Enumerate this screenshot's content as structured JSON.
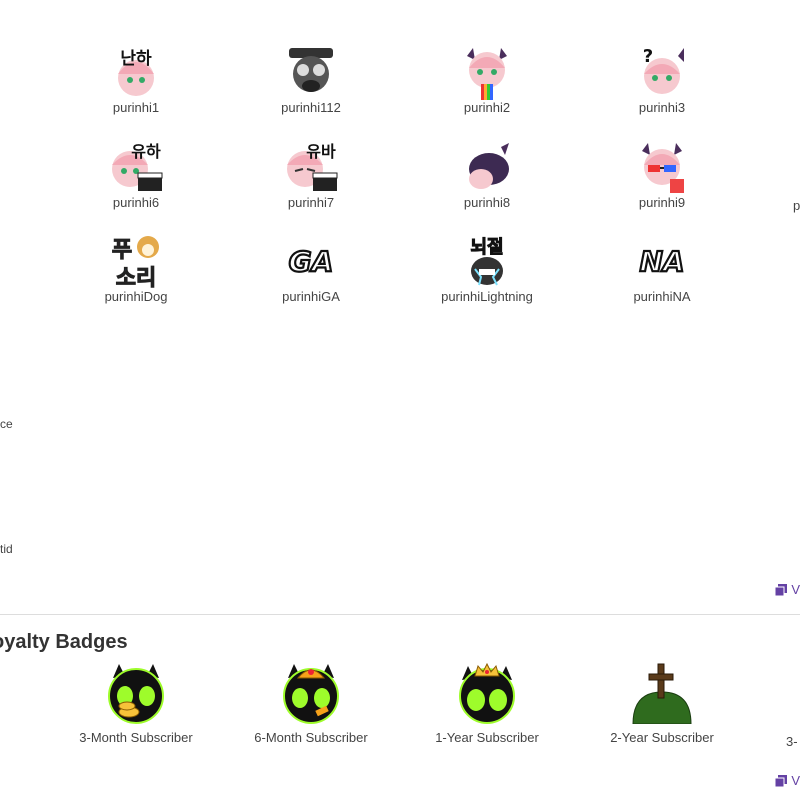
{
  "emotes": [
    {
      "name": "purinhi1",
      "overlay": "난하"
    },
    {
      "name": "purinhi112",
      "overlay": ""
    },
    {
      "name": "purinhi2",
      "overlay": ""
    },
    {
      "name": "purinhi3",
      "overlay": "?"
    },
    {
      "name": "purinhi6",
      "overlay": "유하"
    },
    {
      "name": "purinhi7",
      "overlay": "유바"
    },
    {
      "name": "purinhi8",
      "overlay": ""
    },
    {
      "name": "purinhi9",
      "overlay": ""
    },
    {
      "name": "purinhiDog",
      "overlay_top": "푸",
      "overlay_bottom": "소리"
    },
    {
      "name": "purinhiGA",
      "overlay": "GA"
    },
    {
      "name": "purinhiLightning",
      "overlay": "뇌절"
    },
    {
      "name": "purinhiNA",
      "overlay": "NA"
    }
  ],
  "clipped": {
    "row2_right": "p",
    "side_text_1": "ce",
    "side_text_2": "tid",
    "view_link_1": "V",
    "view_link_2": "V"
  },
  "section": {
    "title": "oyalty Badges"
  },
  "badges": [
    {
      "label": "3-Month Subscriber",
      "icon": "devil-coins-badge-icon"
    },
    {
      "label": "6-Month Subscriber",
      "icon": "devil-helmet-badge-icon"
    },
    {
      "label": "1-Year Subscriber",
      "icon": "devil-crown-badge-icon"
    },
    {
      "label": "2-Year Subscriber",
      "icon": "grave-badge-icon"
    },
    {
      "label": "3-",
      "icon": ""
    }
  ],
  "colors": {
    "accent": "#6441a4",
    "badge_green": "#9efc2b",
    "badge_black": "#111111",
    "grave_green": "#2f6b1e"
  }
}
